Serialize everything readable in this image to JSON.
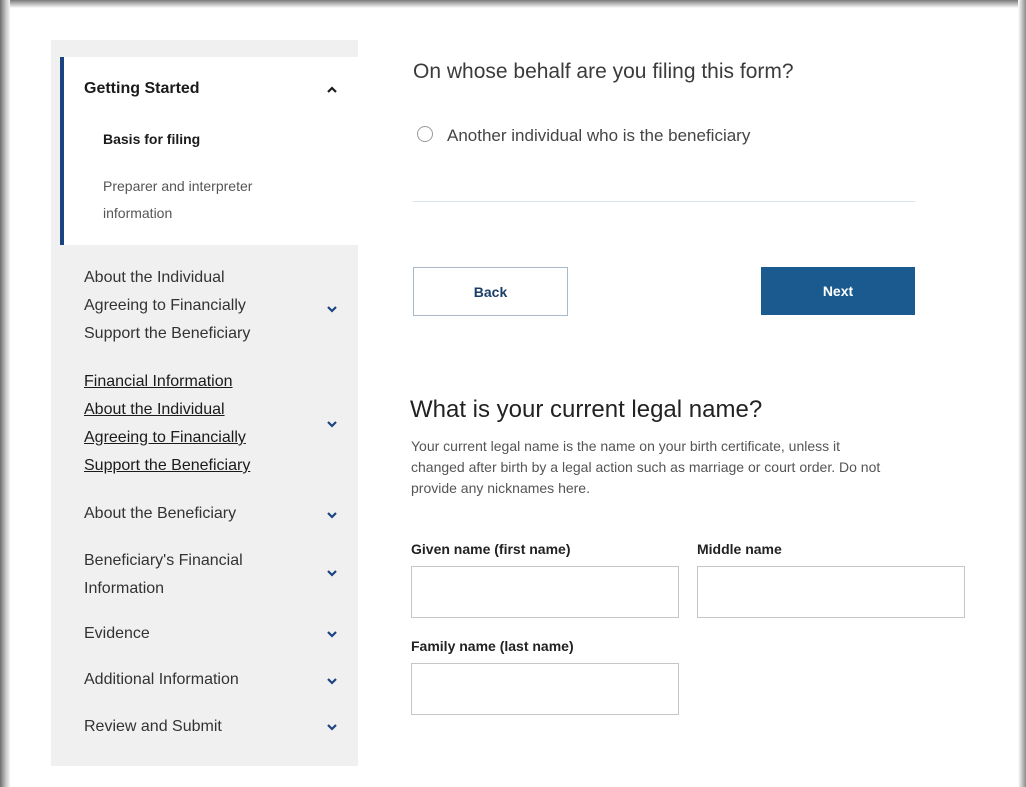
{
  "sidebar": {
    "active_section": {
      "title": "Getting Started",
      "items": [
        {
          "label": "Basis for filing",
          "current": true
        },
        {
          "label_line1": "Preparer and interpreter",
          "label_line2": "information",
          "current": false
        }
      ]
    },
    "sections": [
      {
        "lines": [
          "About the Individual",
          "Agreeing to Financially",
          "Support the Beneficiary"
        ],
        "link": false
      },
      {
        "lines": [
          "Financial Information",
          "About the Individual",
          "Agreeing to Financially",
          "Support the Beneficiary"
        ],
        "link": true
      },
      {
        "lines": [
          "About the Beneficiary"
        ],
        "link": false
      },
      {
        "lines": [
          "Beneficiary's Financial",
          "Information"
        ],
        "link": false
      },
      {
        "lines": [
          "Evidence"
        ],
        "link": false
      },
      {
        "lines": [
          "Additional Information"
        ],
        "link": false
      },
      {
        "lines": [
          "Review and Submit"
        ],
        "link": false
      }
    ]
  },
  "question": {
    "title": "On whose behalf are you filing this form?",
    "option_label": "Another individual who is the beneficiary",
    "option_selected": false
  },
  "buttons": {
    "back": "Back",
    "next": "Next"
  },
  "legal_name": {
    "title": "What is your current legal name?",
    "help_line1": "Your current legal name is the name on your birth certificate, unless it",
    "help_line2": "changed after birth by a legal action such as marriage or court order. Do not",
    "help_line3": "provide any nicknames here.",
    "given_label": "Given name (first name)",
    "given_value": "",
    "middle_label": "Middle name",
    "middle_value": "",
    "family_label": "Family name (last name)",
    "family_value": ""
  },
  "colors": {
    "primary": "#1a5a8e",
    "accent_border": "#1a4480",
    "sidebar_bg": "#f0f0f0"
  },
  "icons": {
    "expanded": "chevron-up-icon",
    "collapsed": "chevron-down-icon"
  }
}
